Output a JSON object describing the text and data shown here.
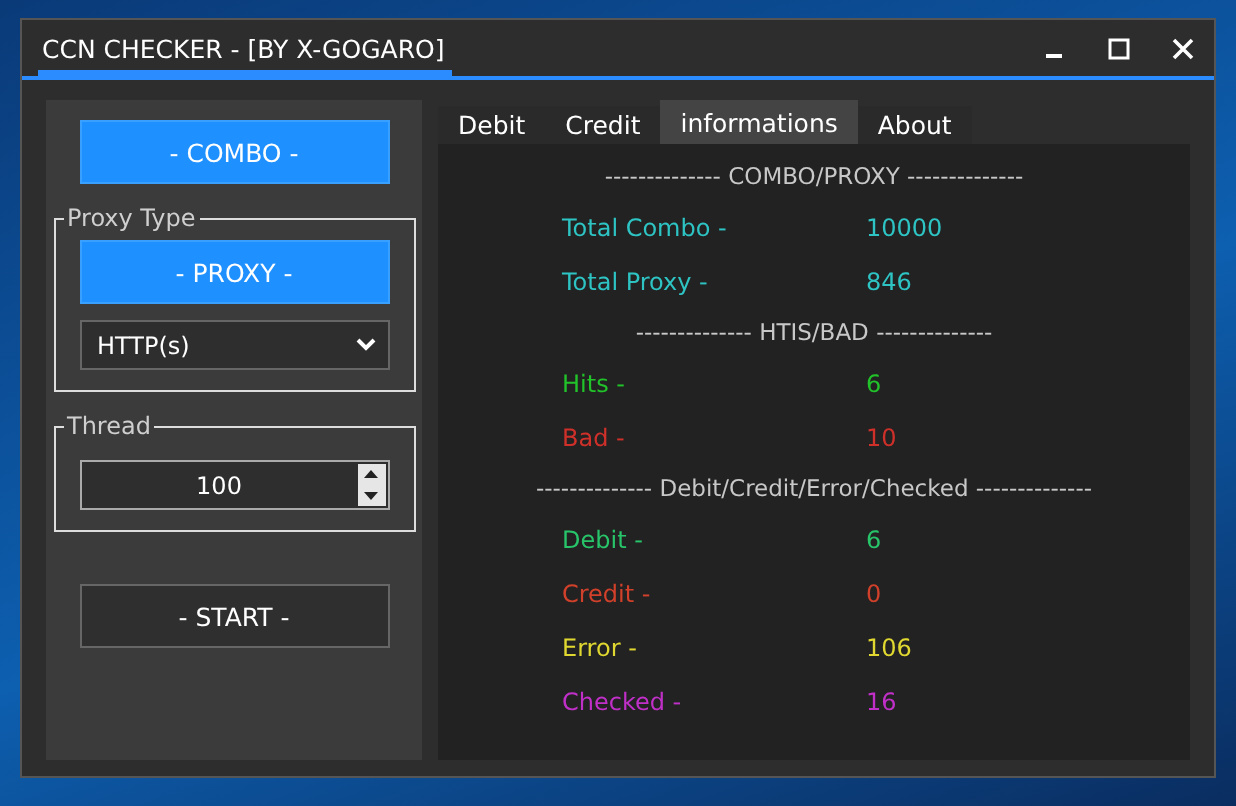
{
  "window": {
    "title": "CCN CHECKER - [BY X-GOGARO]"
  },
  "left_panel": {
    "combo_button": "- COMBO -",
    "proxy_group": {
      "label": "Proxy Type",
      "button": "- PROXY -",
      "select_value": "HTTP(s)"
    },
    "thread_group": {
      "label": "Thread",
      "value": "100"
    },
    "start_button": "- START -"
  },
  "tabs": [
    {
      "label": "Debit",
      "selected": false
    },
    {
      "label": "Credit",
      "selected": false
    },
    {
      "label": "informations",
      "selected": true
    },
    {
      "label": "About",
      "selected": false
    }
  ],
  "sections": [
    {
      "heading": "-------------- COMBO/PROXY --------------",
      "rows": [
        {
          "label": "Total Combo -",
          "value": "10000",
          "color": "#2ec4c4"
        },
        {
          "label": "Total Proxy -",
          "value": "846",
          "color": "#2ec4c4"
        }
      ]
    },
    {
      "heading": "-------------- HTIS/BAD --------------",
      "rows": [
        {
          "label": "Hits -",
          "value": "6",
          "color": "#22c22a"
        },
        {
          "label": "Bad -",
          "value": "10",
          "color": "#d0302a"
        }
      ]
    },
    {
      "heading": "-------------- Debit/Credit/Error/Checked --------------",
      "rows": [
        {
          "label": "Debit -",
          "value": "6",
          "color": "#28c46a"
        },
        {
          "label": "Credit -",
          "value": "0",
          "color": "#d0402a"
        },
        {
          "label": "Error -",
          "value": "106",
          "color": "#e0d830"
        },
        {
          "label": "Checked -",
          "value": "16",
          "color": "#c030c8"
        }
      ]
    }
  ]
}
